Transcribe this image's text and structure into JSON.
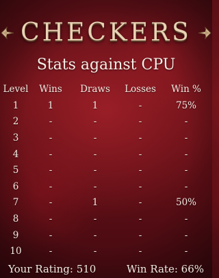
{
  "logo": {
    "text": "CHECKERS"
  },
  "subtitle": "Stats against CPU",
  "table": {
    "headers": [
      "Level",
      "Wins",
      "Draws",
      "Losses",
      "Win %"
    ],
    "rows": [
      [
        "1",
        "1",
        "1",
        "-",
        "75%"
      ],
      [
        "2",
        "-",
        "-",
        "-",
        "-"
      ],
      [
        "3",
        "-",
        "-",
        "-",
        "-"
      ],
      [
        "4",
        "-",
        "-",
        "-",
        "-"
      ],
      [
        "5",
        "-",
        "-",
        "-",
        "-"
      ],
      [
        "6",
        "-",
        "-",
        "-",
        "-"
      ],
      [
        "7",
        "-",
        "1",
        "-",
        "50%"
      ],
      [
        "8",
        "-",
        "-",
        "-",
        "-"
      ],
      [
        "9",
        "-",
        "-",
        "-",
        "-"
      ],
      [
        "10",
        "-",
        "-",
        "-",
        "-"
      ]
    ]
  },
  "footer": {
    "rating_label": "Your Rating: 510",
    "win_rate_label": "Win Rate: 66%"
  },
  "colors": {
    "background": "#6e1219",
    "logo_gold": "#e8d3b4",
    "text": "#f3e9e1"
  }
}
